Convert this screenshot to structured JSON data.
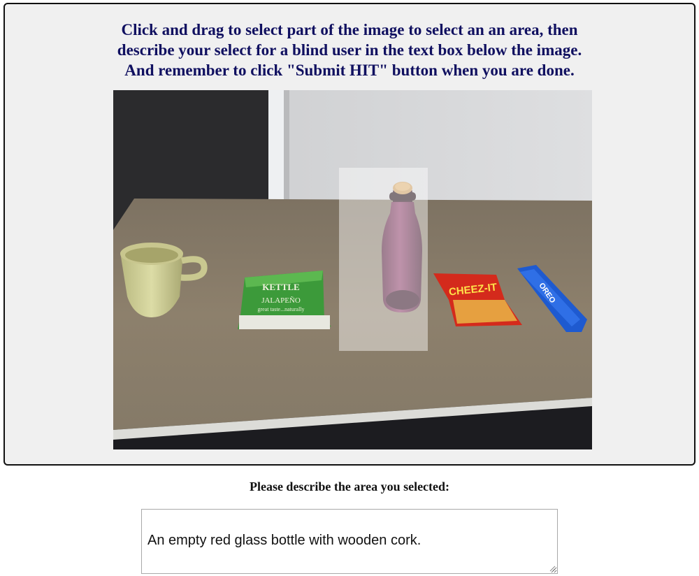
{
  "instructions": {
    "line1": "Click and drag to select part of the image to select an an area, then",
    "line2": "describe your select for a blind user in the text box below the image.",
    "line3": "And remember to click \"Submit HIT\" button when you are done."
  },
  "image": {
    "packet_brand": "KETTLE",
    "packet_flavor": "JALAPEÑO",
    "packet_tagline": "great taste...naturally",
    "cracker_brand": "CHEEZ-IT",
    "cookie_brand": "OREO"
  },
  "prompt": {
    "label": "Please describe the area you selected:"
  },
  "description": {
    "value": "An empty red glass bottle with wooden cork."
  },
  "colors": {
    "instruction_text": "#101060",
    "panel_background": "#f0f0f0",
    "table_top": "#8a7c68",
    "bottle": "#7a2a55"
  }
}
